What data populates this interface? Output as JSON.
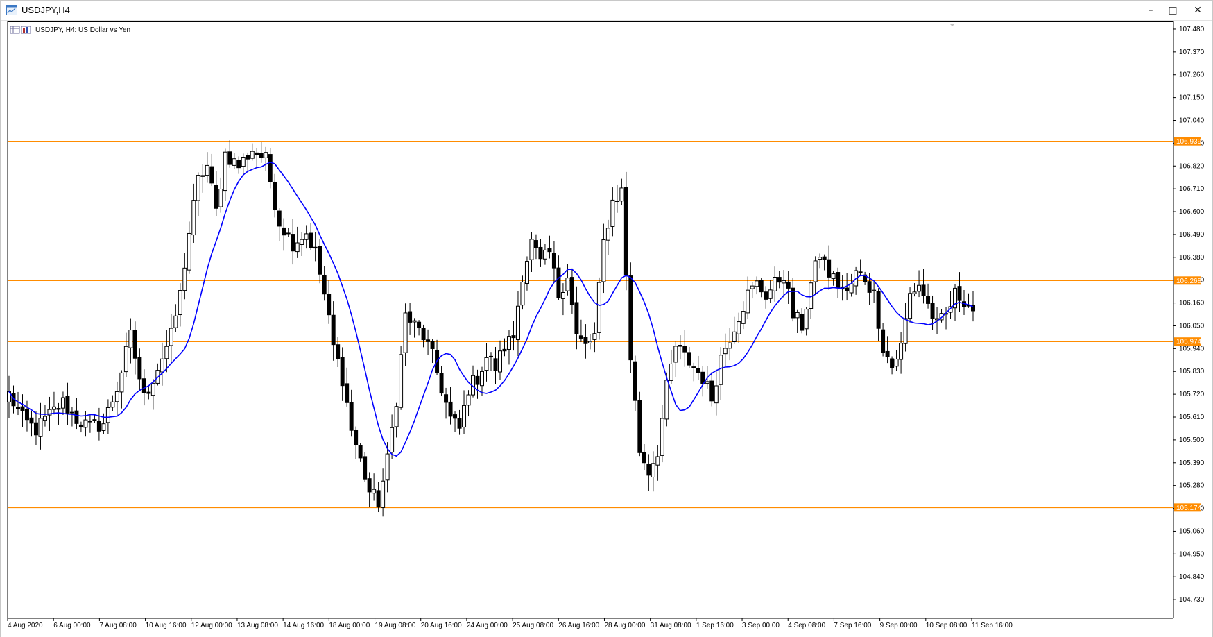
{
  "window": {
    "title": "USDJPY,H4",
    "buttons": {
      "minimize": "–",
      "maximize": "□",
      "close": "✕"
    }
  },
  "chart_data": {
    "type": "candlestick",
    "symbol_label": "USDJPY, H4:  US Dollar vs Yen",
    "ylim": [
      104.64,
      107.52
    ],
    "y_ticks": [
      "107.480",
      "107.370",
      "107.260",
      "107.150",
      "107.040",
      "106.930",
      "106.820",
      "106.710",
      "106.600",
      "106.490",
      "106.380",
      "106.270",
      "106.160",
      "106.050",
      "105.940",
      "105.830",
      "105.720",
      "105.610",
      "105.500",
      "105.390",
      "105.280",
      "105.170",
      "105.060",
      "104.950",
      "104.840",
      "104.730"
    ],
    "x_labels": [
      "4 Aug 2020",
      "6 Aug 00:00",
      "7 Aug 08:00",
      "10 Aug 16:00",
      "12 Aug 00:00",
      "13 Aug 08:00",
      "14 Aug 16:00",
      "18 Aug 00:00",
      "19 Aug 08:00",
      "20 Aug 16:00",
      "24 Aug 00:00",
      "25 Aug 08:00",
      "26 Aug 16:00",
      "28 Aug 00:00",
      "31 Aug 08:00",
      "1 Sep 16:00",
      "3 Sep 00:00",
      "4 Sep 08:00",
      "7 Sep 16:00",
      "9 Sep 00:00",
      "10 Sep 08:00",
      "11 Sep 16:00"
    ],
    "levels": [
      {
        "value": 106.939,
        "label": "106.939",
        "color": "#ff8c00"
      },
      {
        "value": 106.268,
        "label": "106.268",
        "color": "#ff8c00"
      },
      {
        "value": 105.974,
        "label": "105.974",
        "color": "#ff8c00"
      },
      {
        "value": 105.174,
        "label": "105.174",
        "color": "#ff8c00"
      }
    ],
    "ma_color": "#0000ff",
    "bull_color": "#ffffff",
    "bear_color": "#000000",
    "anchors": [
      [
        0,
        105.72
      ],
      [
        3,
        105.6
      ],
      [
        6,
        105.55
      ],
      [
        9,
        105.62
      ],
      [
        12,
        105.68
      ],
      [
        15,
        105.6
      ],
      [
        18,
        105.56
      ],
      [
        21,
        105.58
      ],
      [
        24,
        105.75
      ],
      [
        27,
        106.0
      ],
      [
        30,
        105.7
      ],
      [
        33,
        105.85
      ],
      [
        36,
        106.0
      ],
      [
        38,
        106.2
      ],
      [
        40,
        106.5
      ],
      [
        42,
        106.75
      ],
      [
        44,
        106.82
      ],
      [
        46,
        106.6
      ],
      [
        48,
        106.88
      ],
      [
        51,
        106.82
      ],
      [
        54,
        106.9
      ],
      [
        57,
        106.85
      ],
      [
        60,
        106.55
      ],
      [
        63,
        106.45
      ],
      [
        66,
        106.5
      ],
      [
        68,
        106.4
      ],
      [
        70,
        106.2
      ],
      [
        72,
        105.95
      ],
      [
        74,
        105.8
      ],
      [
        76,
        105.55
      ],
      [
        78,
        105.4
      ],
      [
        80,
        105.25
      ],
      [
        82,
        105.2
      ],
      [
        84,
        105.4
      ],
      [
        86,
        105.7
      ],
      [
        88,
        106.1
      ],
      [
        90,
        106.05
      ],
      [
        92,
        106.0
      ],
      [
        94,
        105.9
      ],
      [
        96,
        105.75
      ],
      [
        98,
        105.6
      ],
      [
        100,
        105.55
      ],
      [
        102,
        105.75
      ],
      [
        104,
        105.8
      ],
      [
        106,
        105.9
      ],
      [
        108,
        105.85
      ],
      [
        110,
        105.95
      ],
      [
        112,
        106.0
      ],
      [
        114,
        106.3
      ],
      [
        116,
        106.45
      ],
      [
        118,
        106.35
      ],
      [
        120,
        106.4
      ],
      [
        122,
        106.2
      ],
      [
        124,
        106.3
      ],
      [
        126,
        106.0
      ],
      [
        128,
        105.95
      ],
      [
        130,
        106.0
      ],
      [
        132,
        106.45
      ],
      [
        134,
        106.65
      ],
      [
        136,
        106.7
      ],
      [
        138,
        105.9
      ],
      [
        140,
        105.45
      ],
      [
        142,
        105.35
      ],
      [
        144,
        105.45
      ],
      [
        146,
        105.75
      ],
      [
        148,
        105.95
      ],
      [
        150,
        105.9
      ],
      [
        152,
        105.85
      ],
      [
        154,
        105.8
      ],
      [
        156,
        105.7
      ],
      [
        158,
        105.9
      ],
      [
        160,
        106.0
      ],
      [
        162,
        106.1
      ],
      [
        164,
        106.2
      ],
      [
        166,
        106.25
      ],
      [
        168,
        106.2
      ],
      [
        170,
        106.25
      ],
      [
        172,
        106.3
      ],
      [
        174,
        106.1
      ],
      [
        176,
        106.05
      ],
      [
        178,
        106.25
      ],
      [
        180,
        106.4
      ],
      [
        182,
        106.3
      ],
      [
        184,
        106.25
      ],
      [
        186,
        106.2
      ],
      [
        188,
        106.3
      ],
      [
        190,
        106.28
      ],
      [
        192,
        106.2
      ],
      [
        194,
        105.95
      ],
      [
        196,
        105.85
      ],
      [
        198,
        105.95
      ],
      [
        200,
        106.2
      ],
      [
        202,
        106.25
      ],
      [
        204,
        106.15
      ],
      [
        206,
        106.05
      ],
      [
        208,
        106.1
      ],
      [
        210,
        106.2
      ],
      [
        212,
        106.18
      ],
      [
        214,
        106.13
      ]
    ]
  }
}
